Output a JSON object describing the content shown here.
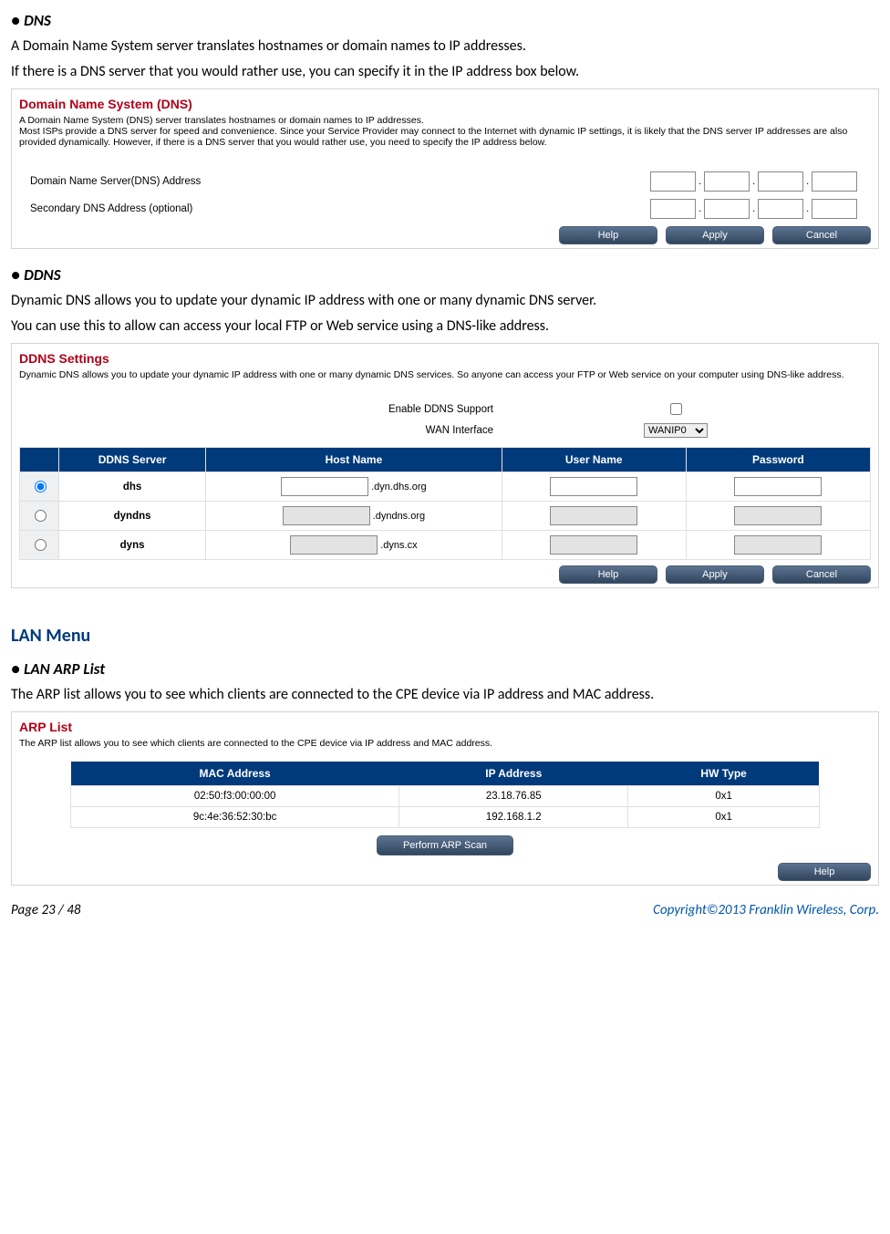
{
  "sec_dns": {
    "heading": "DNS",
    "p1": "A Domain Name System server translates hostnames or domain names to IP addresses.",
    "p2": "If there is a DNS server that you would rather use, you can specify it in the IP address box below."
  },
  "panel_dns": {
    "title": "Domain Name System (DNS)",
    "desc1": "A Domain Name System (DNS) server translates hostnames or domain names to IP addresses.",
    "desc2": "Most ISPs provide a DNS server for speed and convenience. Since your Service Provider may connect to the Internet with dynamic IP settings, it is likely that the DNS server IP addresses are also provided dynamically. However, if there is a DNS server that you would rather use, you need to specify the IP address below.",
    "row1_label": "Domain Name Server(DNS) Address",
    "row2_label": "Secondary DNS Address (optional)",
    "btn_help": "Help",
    "btn_apply": "Apply",
    "btn_cancel": "Cancel"
  },
  "sec_ddns": {
    "heading": "DDNS",
    "p1": "Dynamic DNS allows you to update your dynamic IP address with one or many dynamic DNS server.",
    "p2": "You can use this to allow can access your local FTP or Web service using a DNS-like address."
  },
  "panel_ddns": {
    "title": "DDNS Settings",
    "desc": "Dynamic DNS allows you to update your dynamic IP address with one or many dynamic DNS services. So anyone can access your FTP or Web service on your computer using DNS-like address.",
    "enable_label": "Enable DDNS Support",
    "wan_label": "WAN Interface",
    "wan_option": "WANIP0",
    "col_server": "DDNS Server",
    "col_hostname": "Host Name",
    "col_username": "User Name",
    "col_password": "Password",
    "rows": [
      {
        "server": "dhs",
        "suffix": ".dyn.dhs.org",
        "enabled": true
      },
      {
        "server": "dyndns",
        "suffix": ".dyndns.org",
        "enabled": false
      },
      {
        "server": "dyns",
        "suffix": ".dyns.cx",
        "enabled": false
      }
    ],
    "btn_help": "Help",
    "btn_apply": "Apply",
    "btn_cancel": "Cancel"
  },
  "lan_heading": "LAN Menu",
  "sec_arp": {
    "heading": "LAN ARP List",
    "p1": "The ARP list allows you to see which clients are connected to the CPE device via IP address and MAC address."
  },
  "panel_arp": {
    "title": "ARP List",
    "desc": "The ARP list allows you to see which clients are connected to the CPE device via IP address and MAC address.",
    "col_mac": "MAC Address",
    "col_ip": "IP Address",
    "col_hw": "HW Type",
    "rows": [
      {
        "mac": "02:50:f3:00:00:00",
        "ip": "23.18.76.85",
        "hw": "0x1"
      },
      {
        "mac": "9c:4e:36:52:30:bc",
        "ip": "192.168.1.2",
        "hw": "0x1"
      }
    ],
    "btn_scan": "Perform ARP Scan",
    "btn_help": "Help"
  },
  "footer": {
    "left": "Page  23  /  48",
    "right": "Copyright©2013  Franklin  Wireless, Corp."
  }
}
